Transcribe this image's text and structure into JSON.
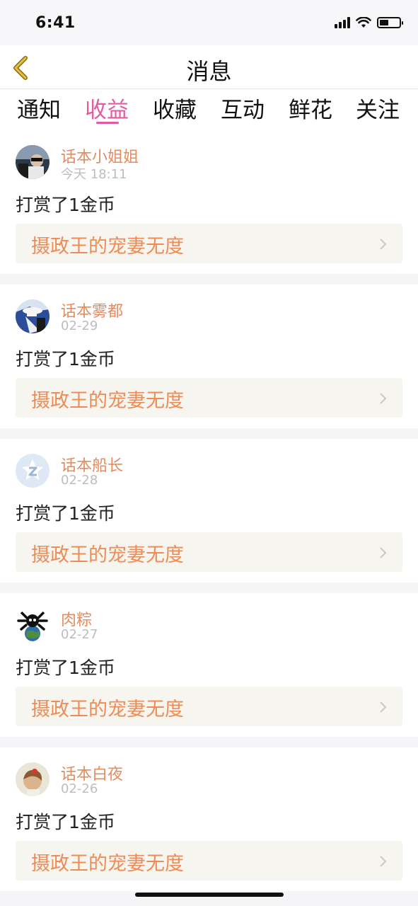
{
  "status_bar": {
    "time": "6:41"
  },
  "header": {
    "title": "消息"
  },
  "tabs": [
    {
      "label": "通知",
      "active": false
    },
    {
      "label": "收益",
      "active": true
    },
    {
      "label": "收藏",
      "active": false
    },
    {
      "label": "互动",
      "active": false
    },
    {
      "label": "鲜花",
      "active": false
    },
    {
      "label": "关注",
      "active": false
    }
  ],
  "messages": [
    {
      "user": "话本小姐姐",
      "date": "今天 18:11",
      "text": "打赏了1金币",
      "book": "摄政王的宠妻无度"
    },
    {
      "user": "话本雾都",
      "date": "02-29",
      "text": "打赏了1金币",
      "book": "摄政王的宠妻无度"
    },
    {
      "user": "话本船长",
      "date": "02-28",
      "text": "打赏了1金币",
      "book": "摄政王的宠妻无度"
    },
    {
      "user": "肉粽",
      "date": "02-27",
      "text": "打赏了1金币",
      "book": "摄政王的宠妻无度"
    },
    {
      "user": "话本白夜",
      "date": "02-26",
      "text": "打赏了1金币",
      "book": "摄政王的宠妻无度"
    }
  ],
  "colors": {
    "accent": "#e45a9e",
    "username": "#e58b5e",
    "book_title": "#ef8c56",
    "back_icon": "#c9a02a"
  }
}
